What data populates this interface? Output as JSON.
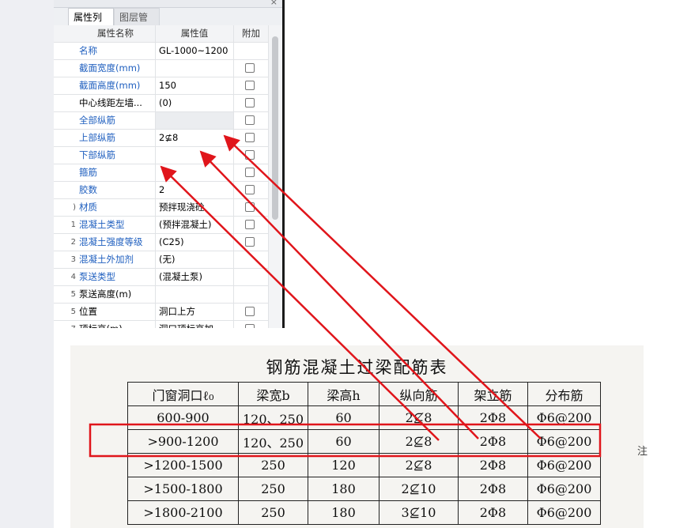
{
  "panel": {
    "close_glyph": "×",
    "tabs": [
      {
        "label": "属性列表",
        "active": true
      },
      {
        "label": "图层管理",
        "active": false
      }
    ],
    "headers": {
      "name": "属性名称",
      "value": "属性值",
      "extra": "附加"
    },
    "rows": [
      {
        "num": "",
        "name": "名称",
        "value": "GL-1000~1200",
        "blue": true,
        "checkbox": false,
        "greyValue": false
      },
      {
        "num": "",
        "name": "截面宽度(mm)",
        "value": "",
        "blue": true,
        "checkbox": true,
        "greyValue": false
      },
      {
        "num": "",
        "name": "截面高度(mm)",
        "value": "150",
        "blue": true,
        "checkbox": true,
        "greyValue": false
      },
      {
        "num": "",
        "name": "中心线距左墙...",
        "value": "(0)",
        "blue": false,
        "checkbox": true,
        "greyValue": false
      },
      {
        "num": "",
        "name": "全部纵筋",
        "value": "",
        "blue": true,
        "checkbox": true,
        "greyValue": true
      },
      {
        "num": "",
        "name": "上部纵筋",
        "value": "2⊈8",
        "blue": true,
        "checkbox": true,
        "greyValue": false
      },
      {
        "num": "",
        "name": "下部纵筋",
        "value": "",
        "blue": true,
        "checkbox": true,
        "greyValue": false
      },
      {
        "num": "",
        "name": "箍筋",
        "value": "",
        "blue": true,
        "checkbox": true,
        "greyValue": false
      },
      {
        "num": "",
        "name": "胶数",
        "value": "2",
        "blue": true,
        "checkbox": true,
        "greyValue": false
      },
      {
        "num": ")",
        "name": "材质",
        "value": "预拌现浇砼",
        "blue": true,
        "checkbox": true,
        "greyValue": false
      },
      {
        "num": "1",
        "name": "混凝土类型",
        "value": "(预拌混凝土)",
        "blue": true,
        "checkbox": true,
        "greyValue": false
      },
      {
        "num": "2",
        "name": "混凝土强度等级",
        "value": "(C25)",
        "blue": true,
        "checkbox": true,
        "greyValue": false
      },
      {
        "num": "3",
        "name": "混凝土外加剂",
        "value": "(无)",
        "blue": true,
        "checkbox": false,
        "greyValue": false
      },
      {
        "num": "4",
        "name": "泵送类型",
        "value": "(混凝土泵)",
        "blue": true,
        "checkbox": false,
        "greyValue": false
      },
      {
        "num": "5",
        "name": "泵送高度(m)",
        "value": "",
        "blue": false,
        "checkbox": false,
        "greyValue": false
      },
      {
        "num": "5",
        "name": "位置",
        "value": "洞口上方",
        "blue": false,
        "checkbox": true,
        "greyValue": false
      },
      {
        "num": "7",
        "name": "顶标高(m)",
        "value": "洞口顶标高加...",
        "blue": false,
        "checkbox": true,
        "greyValue": false
      },
      {
        "num": "",
        "name": "",
        "value": "",
        "blue": false,
        "checkbox": true,
        "greyValue": false
      }
    ]
  },
  "doc": {
    "title": "钢筋混凝土过梁配筋表",
    "side_note": "注",
    "columns": [
      "门窗洞口ℓ₀",
      "梁宽b",
      "梁高h",
      "纵向筋",
      "架立筋",
      "分布筋"
    ],
    "rows": [
      [
        "600-900",
        "120、250",
        "60",
        "2⊈8",
        "2Φ8",
        "Φ6@200"
      ],
      [
        ">900-1200",
        "120、250",
        "60",
        "2⊈8",
        "2Φ8",
        "Φ6@200"
      ],
      [
        ">1200-1500",
        "250",
        "120",
        "2⊈8",
        "2Φ8",
        "Φ6@200"
      ],
      [
        ">1500-1800",
        "250",
        "180",
        "2⊈10",
        "2Φ8",
        "Φ6@200"
      ],
      [
        ">1800-2100",
        "250",
        "180",
        "3⊈10",
        "2Φ8",
        "Φ6@200"
      ]
    ]
  },
  "annotation_color": "#e0151b"
}
